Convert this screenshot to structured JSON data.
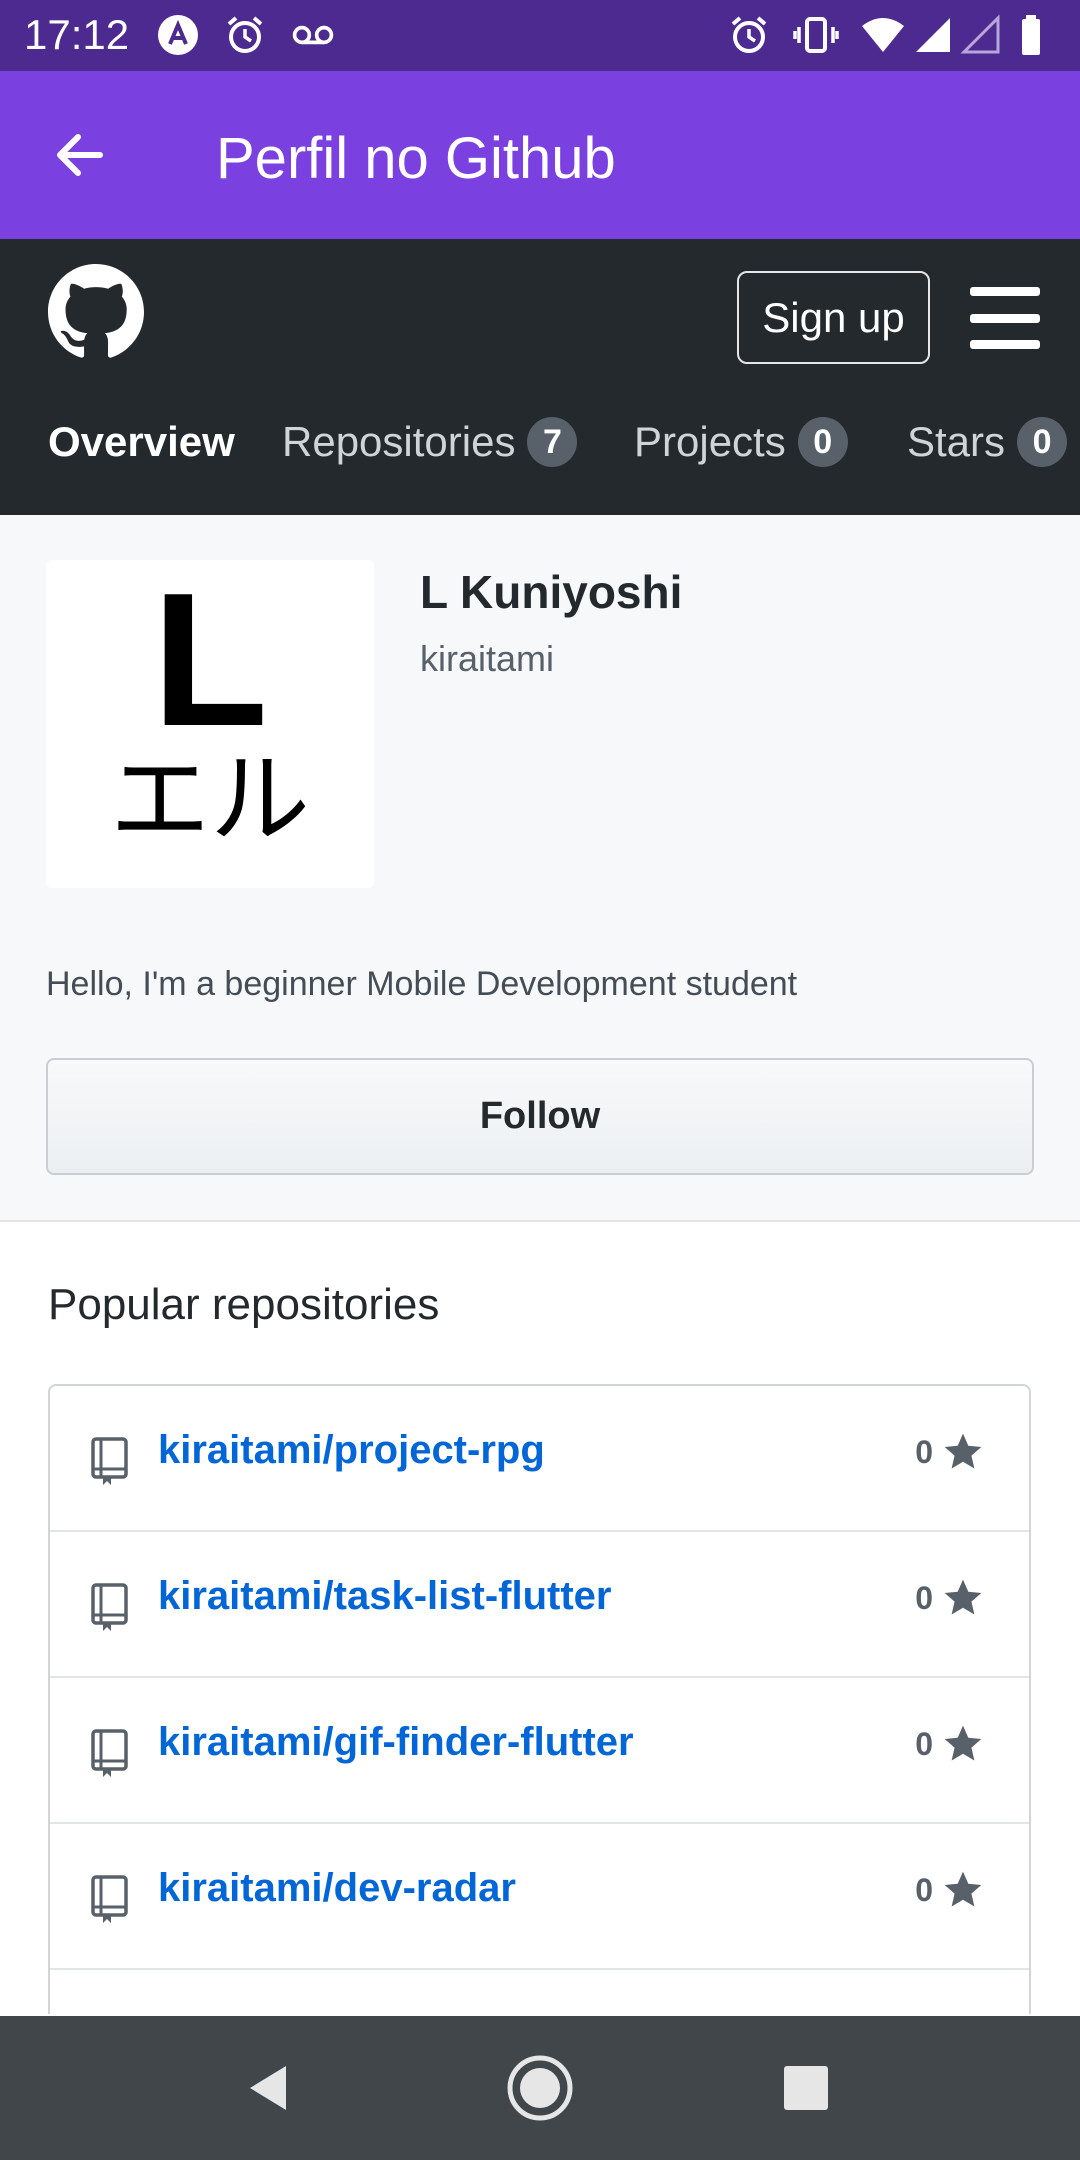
{
  "status_bar": {
    "time": "17:12",
    "icons_left": [
      "app-notification-icon",
      "alarm-icon",
      "voicemail-icon"
    ],
    "icons_right": [
      "alarm-icon",
      "vibrate-icon",
      "wifi-icon",
      "signal-icon",
      "signal-empty-icon",
      "battery-icon"
    ]
  },
  "app_bar": {
    "title": "Perfil no Github",
    "back_icon": "arrow-back-icon"
  },
  "github_header": {
    "logo_icon": "github-octocat-icon",
    "signup_label": "Sign up",
    "menu_icon": "hamburger-menu-icon",
    "tabs": [
      {
        "label": "Overview",
        "count": "",
        "active": true
      },
      {
        "label": "Repositories",
        "count": "7",
        "active": false
      },
      {
        "label": "Projects",
        "count": "0",
        "active": false
      },
      {
        "label": "Stars",
        "count": "0",
        "active": false
      }
    ]
  },
  "profile": {
    "avatar_text_main": "L",
    "avatar_text_sub": "エル",
    "name": "L Kuniyoshi",
    "login": "kiraitami",
    "bio": "Hello, I'm a beginner Mobile Development student",
    "follow_label": "Follow"
  },
  "popular": {
    "title": "Popular repositories",
    "repos": [
      {
        "name": "kiraitami/project-rpg",
        "stars": "0"
      },
      {
        "name": "kiraitami/task-list-flutter",
        "stars": "0"
      },
      {
        "name": "kiraitami/gif-finder-flutter",
        "stars": "0"
      },
      {
        "name": "kiraitami/dev-radar",
        "stars": "0"
      }
    ]
  },
  "nav_bar": {
    "buttons": [
      "back-triangle-icon",
      "home-circle-icon",
      "recents-square-icon"
    ]
  },
  "colors": {
    "status_bar": "#4c2a8f",
    "app_bar": "#7b41e0",
    "github_header": "#24292e",
    "link": "#0366d6",
    "nav_bar": "#41464a"
  }
}
